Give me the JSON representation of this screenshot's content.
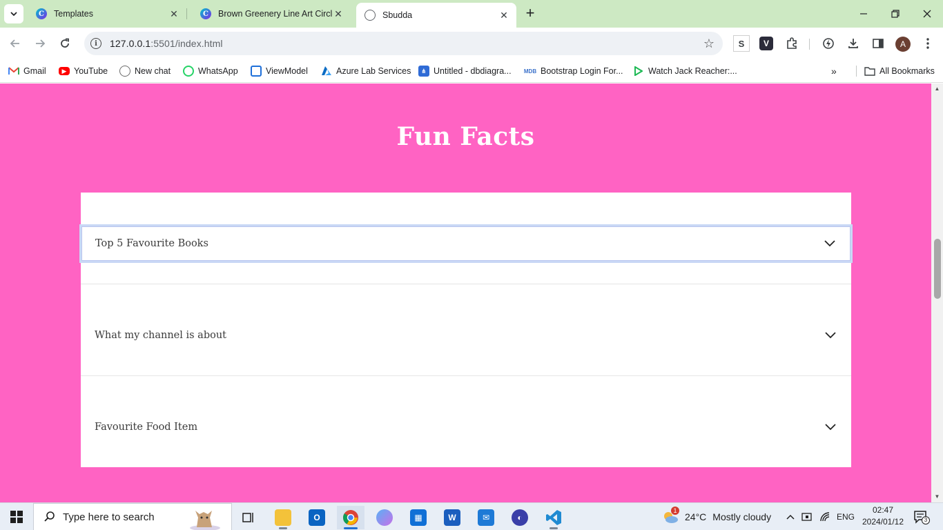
{
  "browser": {
    "tabs": [
      {
        "title": "Templates",
        "favicon": "canva-icon",
        "active": false
      },
      {
        "title": "Brown Greenery Line Art Circle L",
        "favicon": "canva-icon",
        "active": false
      },
      {
        "title": "Sbudda",
        "favicon": "globe-icon",
        "active": true
      }
    ],
    "url_host": "127.0.0.1",
    "url_rest": ":5501/index.html",
    "extensions": [
      "S",
      "V"
    ],
    "avatar_letter": "A",
    "tabbar_color": "#cde9c3"
  },
  "bookmarks": [
    {
      "label": "Gmail",
      "icon": "gmail-icon"
    },
    {
      "label": "YouTube",
      "icon": "youtube-icon"
    },
    {
      "label": "New chat",
      "icon": "openai-icon"
    },
    {
      "label": "WhatsApp",
      "icon": "whatsapp-icon"
    },
    {
      "label": "ViewModel",
      "icon": "viewmodel-icon"
    },
    {
      "label": "Azure Lab Services",
      "icon": "azure-icon"
    },
    {
      "label": "Untitled - dbdiagra...",
      "icon": "dbdiagram-icon"
    },
    {
      "label": "Bootstrap Login For...",
      "icon": "mdb-icon"
    },
    {
      "label": "Watch Jack Reacher:...",
      "icon": "play-icon"
    }
  ],
  "all_bookmarks_label": "All Bookmarks",
  "page": {
    "heading": "Fun Facts",
    "background": "#ff63c3",
    "accordion": [
      {
        "label": "Top 5 Favourite Books",
        "focused": true
      },
      {
        "label": "What my channel is about",
        "focused": false
      },
      {
        "label": "Favourite Food Item",
        "focused": false
      }
    ]
  },
  "taskbar": {
    "search_placeholder": "Type here to search",
    "weather_temp": "24°C",
    "weather_desc": "Mostly cloudy",
    "weather_badge": "1",
    "language": "ENG",
    "time": "02:47",
    "date": "2024/01/12",
    "notification_count": "3"
  }
}
